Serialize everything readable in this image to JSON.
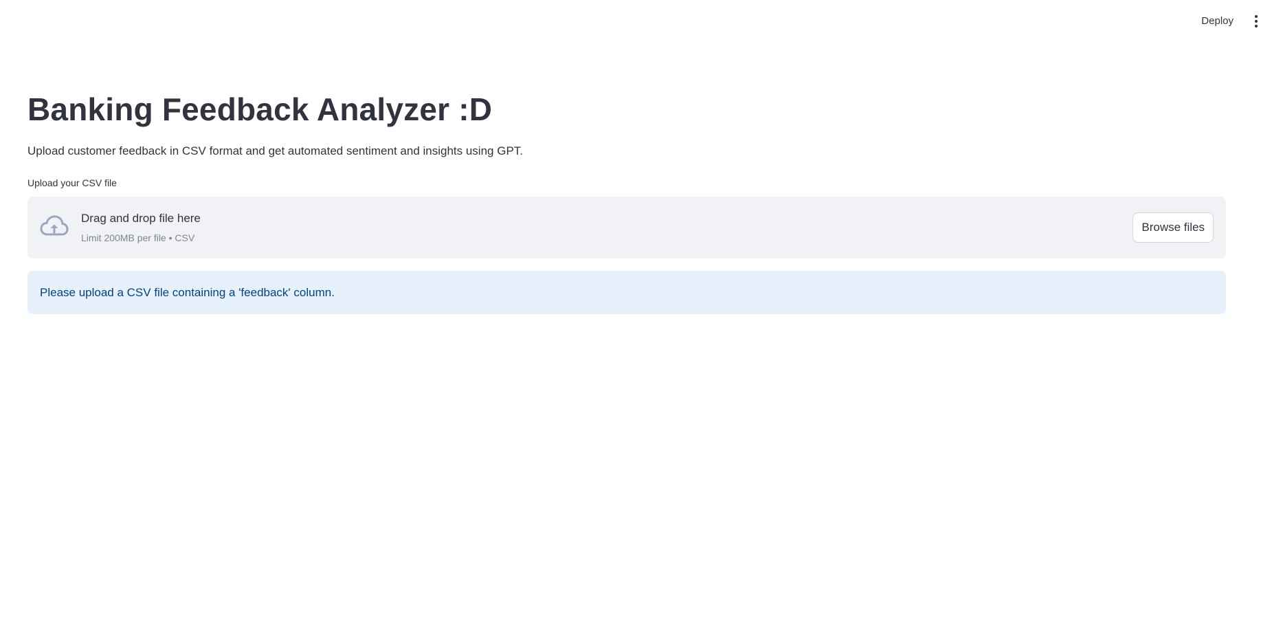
{
  "header": {
    "deploy_label": "Deploy",
    "menu_icon": "vertical-ellipsis-icon"
  },
  "main": {
    "title": "Banking Feedback Analyzer :D",
    "description": "Upload customer feedback in CSV format and get automated sentiment and insights using GPT."
  },
  "uploader": {
    "label": "Upload your CSV file",
    "dropzone_title": "Drag and drop file here",
    "dropzone_limit": "Limit 200MB per file • CSV",
    "browse_label": "Browse files",
    "icon": "cloud-upload-icon"
  },
  "alert": {
    "message": "Please upload a CSV file containing a 'feedback' column."
  },
  "colors": {
    "text": "#31333f",
    "dropzone_bg": "#f0f2f6",
    "info_bg": "#e7f1fc",
    "info_text": "#004280",
    "icon": "#9aa6c0"
  }
}
